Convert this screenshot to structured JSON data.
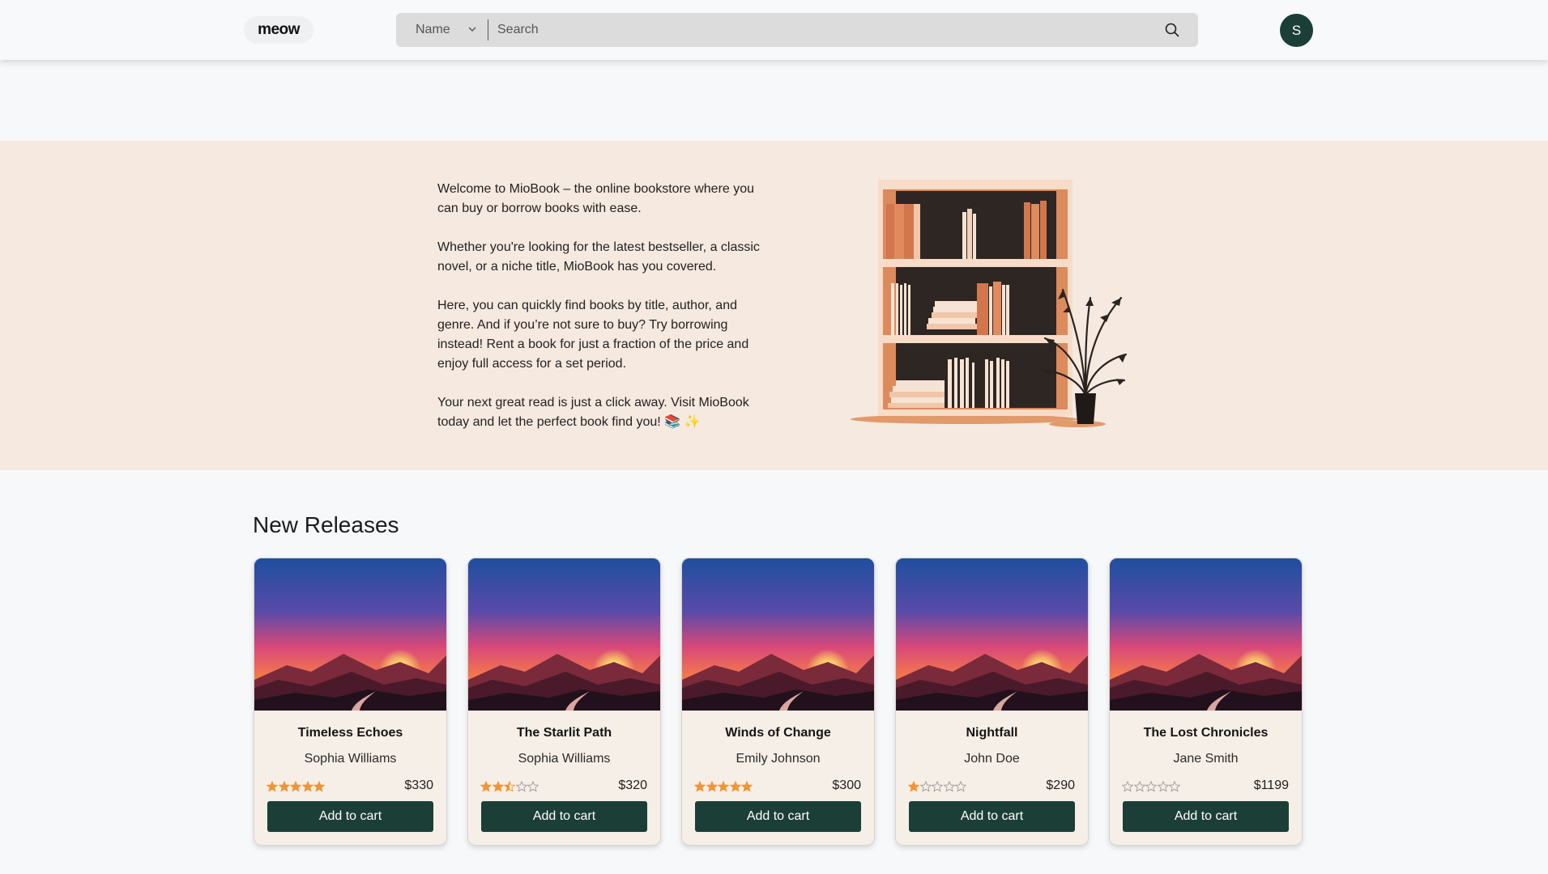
{
  "header": {
    "logo_text": "meow",
    "search": {
      "filter_value": "Name",
      "placeholder": "Search"
    },
    "avatar_initial": "S"
  },
  "hero": {
    "paragraphs": [
      "Welcome to MioBook – the online bookstore where you can buy or borrow books with ease.",
      "Whether you're looking for the latest bestseller, a classic novel, or a niche title, MioBook has you covered.",
      "Here, you can quickly find books by title, author, and genre. And if you’re not sure to buy? Try borrowing instead! Rent a book for just a fraction of the price and enjoy full access for a set period.",
      "Your next great read is just a click away. Visit MioBook today and let the perfect book find you! 📚 ✨"
    ]
  },
  "new_releases": {
    "title": "New Releases",
    "cart_label": "Add to cart",
    "books": [
      {
        "title": "Timeless Echoes",
        "author": "Sophia Williams",
        "rating": 5,
        "price": "$330"
      },
      {
        "title": "The Starlit Path",
        "author": "Sophia Williams",
        "rating": 2.5,
        "price": "$320"
      },
      {
        "title": "Winds of Change",
        "author": "Emily Johnson",
        "rating": 5,
        "price": "$300"
      },
      {
        "title": "Nightfall",
        "author": "John Doe",
        "rating": 1,
        "price": "$290"
      },
      {
        "title": "The Lost Chronicles",
        "author": "Jane Smith",
        "rating": 0,
        "price": "$1199"
      }
    ]
  },
  "colors": {
    "primary": "#1b3f36",
    "hero_bg": "#f6e9df",
    "star": "#f0953a"
  }
}
